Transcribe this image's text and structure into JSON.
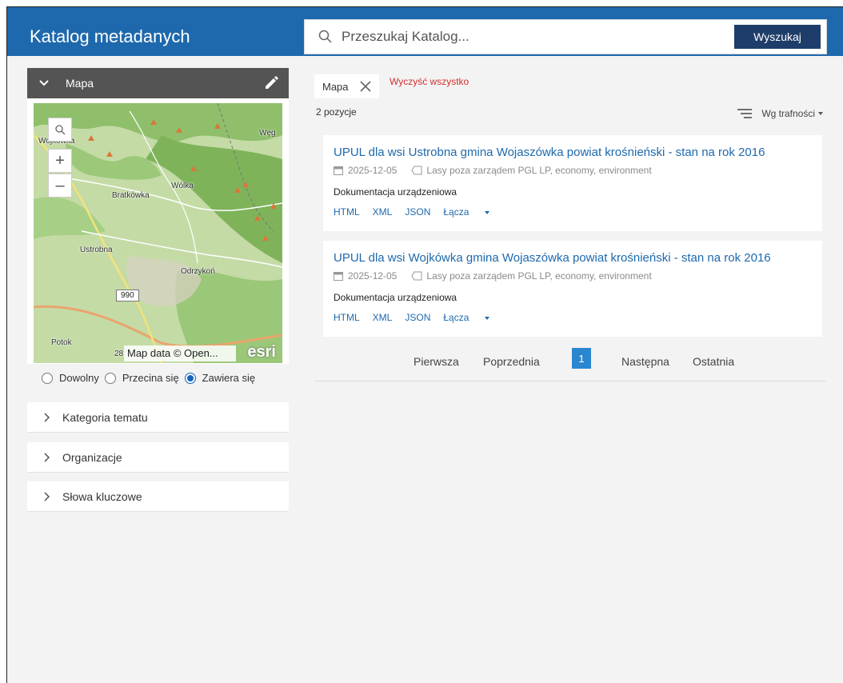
{
  "header": {
    "app_title": "Katalog metadanych",
    "search_placeholder": "Przeszukaj Katalog...",
    "search_button": "Wyszukaj"
  },
  "map_panel": {
    "title": "Mapa",
    "labels": {
      "wojkowka": "Wojkówka",
      "weg": "Węg",
      "wolka": "Wólka",
      "bratkowka": "Bratkówka",
      "ustrobna": "Ustrobna",
      "odrzykon": "Odrzykoń",
      "potok": "Potok",
      "road_990": "990",
      "road_28": "28"
    },
    "attribution": "Map data © Open...",
    "esri": "esri",
    "zoom_in": "+",
    "zoom_out": "–",
    "spatial_options": [
      {
        "label": "Dowolny",
        "selected": false
      },
      {
        "label": "Przecina się",
        "selected": false
      },
      {
        "label": "Zawiera się",
        "selected": true
      }
    ]
  },
  "facets": [
    {
      "label": "Kategoria tematu"
    },
    {
      "label": "Organizacje"
    },
    {
      "label": "Słowa kluczowe"
    }
  ],
  "filters": {
    "active_filter": "Mapa",
    "clear_all": "Wyczyść wszystko"
  },
  "results": {
    "count": "2 pozycje",
    "sort_label": "Wg trafności",
    "items": [
      {
        "title": "UPUL dla wsi Ustrobna gmina Wojaszówka powiat krośnieński - stan na rok 2016",
        "date": "2025-12-05",
        "tags": "Lasy poza zarządem PGL LP, economy, environment",
        "type": "Dokumentacja urządzeniowa",
        "links": [
          "HTML",
          "XML",
          "JSON",
          "Łącza"
        ]
      },
      {
        "title": "UPUL dla wsi Wojkówka gmina Wojaszówka powiat krośnieński - stan na rok 2016",
        "date": "2025-12-05",
        "tags": "Lasy poza zarządem PGL LP, economy, environment",
        "type": "Dokumentacja urządzeniowa",
        "links": [
          "HTML",
          "XML",
          "JSON",
          "Łącza"
        ]
      }
    ]
  },
  "pagination": {
    "first": "Pierwsza",
    "prev": "Poprzednia",
    "current": "1",
    "next": "Następna",
    "last": "Ostatnia"
  },
  "colors": {
    "header_bg": "#1e69ad",
    "search_button_bg": "#1e3d6a",
    "link": "#1e69ad",
    "clear_all": "#d32f2f",
    "current_page": "#2b86d0"
  }
}
